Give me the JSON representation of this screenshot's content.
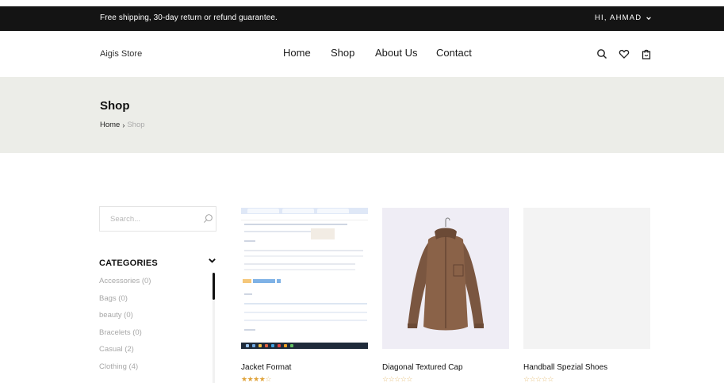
{
  "topbar": {
    "promo": "Free shipping, 30-day return or refund guarantee.",
    "account": "HI, AHMAD"
  },
  "nav": {
    "brand": "Aigis Store",
    "menu": [
      "Home",
      "Shop",
      "About Us",
      "Contact"
    ],
    "icons": [
      "search-icon",
      "heart-icon",
      "shopping-bag-icon"
    ]
  },
  "hero": {
    "title": "Shop",
    "breadcrumb": {
      "home": "Home",
      "separator": "›",
      "current": "Shop"
    }
  },
  "sidebar": {
    "search": {
      "placeholder": "Search...",
      "value": ""
    },
    "categories_title": "CATEGORIES",
    "categories": [
      "Accessories (0)",
      "Bags (0)",
      "beauty (0)",
      "Bracelets (0)",
      "Casual (2)",
      "Clothing (4)"
    ]
  },
  "products": [
    {
      "name": "Jacket Format",
      "rating": 4,
      "image": "screenshot-thumbnail"
    },
    {
      "name": "Diagonal Textured Cap",
      "rating": 0,
      "image": "brown-shirt"
    },
    {
      "name": "Handball Spezial Shoes",
      "rating": 0,
      "image": "blank"
    }
  ],
  "colors": {
    "topbar_bg": "#141414",
    "hero_bg": "#ecede8",
    "star_active": "#e0a33a",
    "star_inactive": "#e6c07c"
  }
}
